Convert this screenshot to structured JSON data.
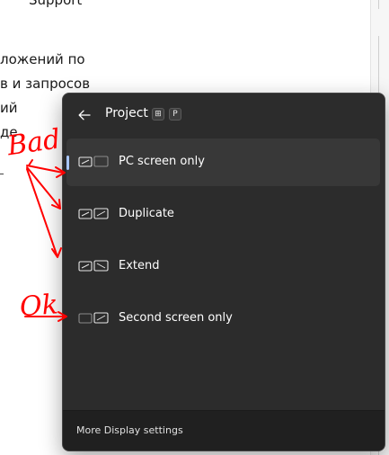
{
  "background": {
    "lines": [
      "Support",
      "ложений по",
      "в и запросов",
      "ий",
      "де"
    ]
  },
  "flyout": {
    "title": "Project",
    "shortcut": [
      "⊞",
      "P"
    ],
    "back_icon": "arrow-left-icon",
    "options": [
      {
        "label": "PC screen only",
        "selected": true,
        "icon": "pc-screen-only-icon"
      },
      {
        "label": "Duplicate",
        "selected": false,
        "icon": "duplicate-icon"
      },
      {
        "label": "Extend",
        "selected": false,
        "icon": "extend-icon"
      },
      {
        "label": "Second screen only",
        "selected": false,
        "icon": "second-screen-only-icon"
      }
    ],
    "footer_link": "More Display settings"
  },
  "annotations": {
    "bad": "Bad",
    "ok": "Ok",
    "color": "#ff0000"
  },
  "colors": {
    "flyout_bg": "#2c2c2c",
    "selected_bg": "#383838",
    "accent": "#a9c6ff",
    "footer_bg": "#202020"
  }
}
